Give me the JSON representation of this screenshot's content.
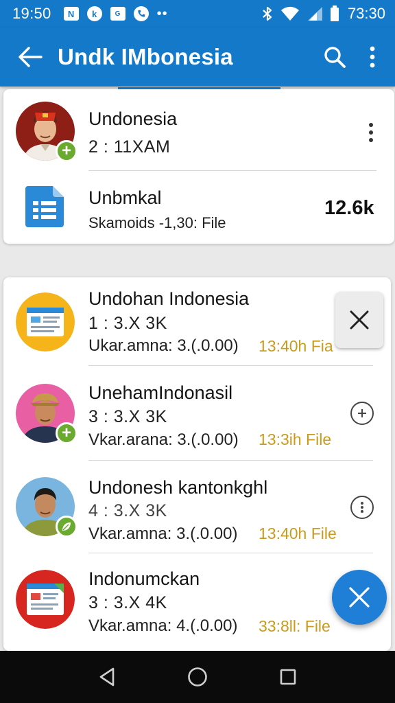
{
  "status_bar": {
    "time": "19:50",
    "icons_left": [
      "N",
      "k",
      "G",
      "phone"
    ],
    "clock_right": "73:30"
  },
  "app_bar": {
    "title": "Undk IMbonesia"
  },
  "pinned_card": {
    "contact": {
      "name": "Undonesia",
      "subtitle": "2 : 11XAM"
    },
    "file": {
      "name": "Unbmkal",
      "subtitle": "Skamoids -1,30: File",
      "size": "12.6k"
    }
  },
  "list_card": {
    "items": [
      {
        "name": "Undohan Indonesia",
        "line1": "1 : 3.X 3K",
        "line2": "Ukar.amna: 3.(.0.00)",
        "meta": "13:40h Fia"
      },
      {
        "name": "UnehamIndonasil",
        "line1": "3 : 3.X 3K",
        "line2": "Vkar.arana: 3.(.0.00)",
        "meta": "13:3ih File"
      },
      {
        "name": "Undonesh kantonkghl",
        "line1": "4 : 3.X 3K",
        "line2": "Vkar.amna: 3.(.0.00)",
        "meta": "13:40h File"
      },
      {
        "name": "Indonumckan",
        "line1": "3 : 3.X 4K",
        "line2": "Vkar.amna: 4.(.0.00)",
        "meta": "33:8ll: File"
      }
    ]
  },
  "colors": {
    "primary": "#1479c9",
    "accent_meta": "#c99a1c",
    "badge_green": "#6aaa2e",
    "fab": "#1f7fd6"
  }
}
